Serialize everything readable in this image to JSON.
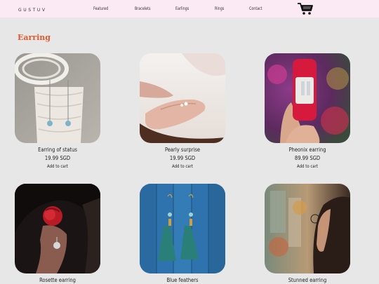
{
  "nav": {
    "brand": "GUSTUV",
    "links": [
      "Featured",
      "Bracelets",
      "Earlings",
      "Rings",
      "Contact"
    ]
  },
  "section": {
    "title": "Earring"
  },
  "products": [
    {
      "name": "Earring of status",
      "price": "19.99 SGD",
      "action": "Add to cart"
    },
    {
      "name": "Pearly surprise",
      "price": "19.99 SGD",
      "action": "Add to cart"
    },
    {
      "name": "Pheonix earring",
      "price": "89.99 SGD",
      "action": "Add to cart"
    },
    {
      "name": "Rosette earring"
    },
    {
      "name": "Blue feathers"
    },
    {
      "name": "Stunned earring"
    }
  ],
  "colors": {
    "nav_bg": "#fbe9f4",
    "accent": "#e1582a",
    "page_bg": "#e7e7e7"
  }
}
